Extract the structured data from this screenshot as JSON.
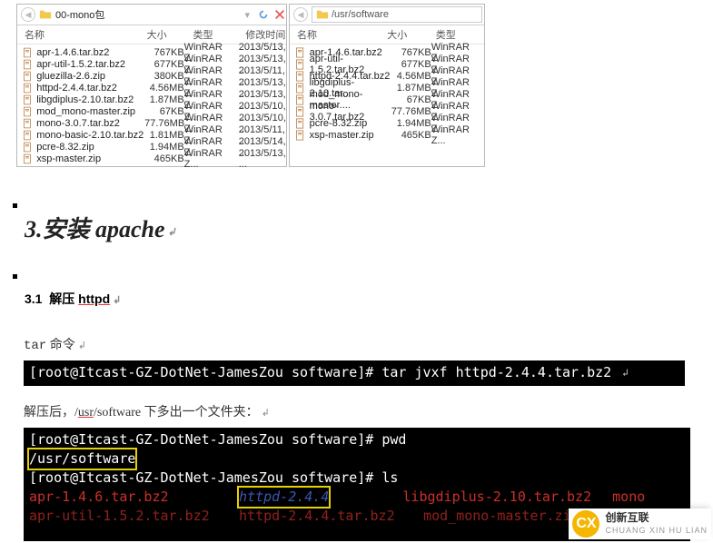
{
  "explorer": {
    "panes": [
      {
        "path": "00-mono包",
        "headers": [
          "名称",
          "大小",
          "类型",
          "修改时间"
        ],
        "files": [
          {
            "name": "apr-1.4.6.tar.bz2",
            "size": "767KB",
            "type": "WinRAR Z...",
            "date": "2013/5/13, ..."
          },
          {
            "name": "apr-util-1.5.2.tar.bz2",
            "size": "677KB",
            "type": "WinRAR Z...",
            "date": "2013/5/13, ..."
          },
          {
            "name": "gluezilla-2.6.zip",
            "size": "380KB",
            "type": "WinRAR Z...",
            "date": "2013/5/11, ..."
          },
          {
            "name": "httpd-2.4.4.tar.bz2",
            "size": "4.56MB",
            "type": "WinRAR Z...",
            "date": "2013/5/13, ..."
          },
          {
            "name": "libgdiplus-2.10.tar.bz2",
            "size": "1.87MB",
            "type": "WinRAR Z...",
            "date": "2013/5/13, ..."
          },
          {
            "name": "mod_mono-master.zip",
            "size": "67KB",
            "type": "WinRAR Z...",
            "date": "2013/5/10, ..."
          },
          {
            "name": "mono-3.0.7.tar.bz2",
            "size": "77.76MB",
            "type": "WinRAR Z...",
            "date": "2013/5/10, ..."
          },
          {
            "name": "mono-basic-2.10.tar.bz2",
            "size": "1.81MB",
            "type": "WinRAR Z...",
            "date": "2013/5/11, ..."
          },
          {
            "name": "pcre-8.32.zip",
            "size": "1.94MB",
            "type": "WinRAR Z...",
            "date": "2013/5/14, ..."
          },
          {
            "name": "xsp-master.zip",
            "size": "465KB",
            "type": "WinRAR Z...",
            "date": "2013/5/13, ..."
          }
        ]
      },
      {
        "path_input": "",
        "path_prefix": "/usr/software",
        "headers": [
          "名称",
          "大小",
          "类型"
        ],
        "files": [
          {
            "name": "apr-1.4.6.tar.bz2",
            "size": "767KB",
            "type": "WinRAR Z..."
          },
          {
            "name": "apr-util-1.5.2.tar.bz2",
            "size": "677KB",
            "type": "WinRAR Z..."
          },
          {
            "name": "httpd-2.4.4.tar.bz2",
            "size": "4.56MB",
            "type": "WinRAR Z..."
          },
          {
            "name": "libgdiplus-2.10.tar...",
            "size": "1.87MB",
            "type": "WinRAR Z..."
          },
          {
            "name": "mod_mono-master....",
            "size": "67KB",
            "type": "WinRAR Z..."
          },
          {
            "name": "mono-3.0.7.tar.bz2",
            "size": "77.76MB",
            "type": "WinRAR Z..."
          },
          {
            "name": "pcre-8.32.zip",
            "size": "1.94MB",
            "type": "WinRAR Z..."
          },
          {
            "name": "xsp-master.zip",
            "size": "465KB",
            "type": "WinRAR Z..."
          }
        ]
      }
    ]
  },
  "sections": {
    "h3_num": "3.",
    "h3_text": "安装 apache",
    "h4_num": "3.1",
    "h4_action": "解压",
    "h4_target": "httpd",
    "para1_prefix": "tar",
    "para1_rest": " 命令",
    "term1": {
      "prompt": "[root@Itcast-GZ-DotNet-JamesZou software]#",
      "cmd": "tar jvxf httpd-2.4.4.tar.bz2"
    },
    "para2_pre": "解压后，/",
    "para2_usr": "usr",
    "para2_post": "/software 下多出一个文件夹：",
    "term2": {
      "line1_prompt": "[root@Itcast-GZ-DotNet-JamesZou software]#",
      "line1_cmd": "pwd",
      "line2": "/usr/software",
      "line3_prompt": "[root@Itcast-GZ-DotNet-JamesZou software]#",
      "line3_cmd": "ls",
      "line4_a": "apr-1.4.6.tar.bz2",
      "line4_b": "httpd-2.4.4",
      "line4_c": "libgdiplus-2.10.tar.bz2",
      "line4_d": "mono",
      "line5_a": "apr-util-1.5.2.tar.bz2",
      "line5_b": "httpd-2.4.4.tar.bz2",
      "line5_c": "mod_mono-master.zi"
    }
  },
  "watermark": {
    "logo": "CX",
    "name": "创新互联",
    "sub": "CHUANG XIN HU LIAN"
  },
  "cursor_glyph": "↲"
}
